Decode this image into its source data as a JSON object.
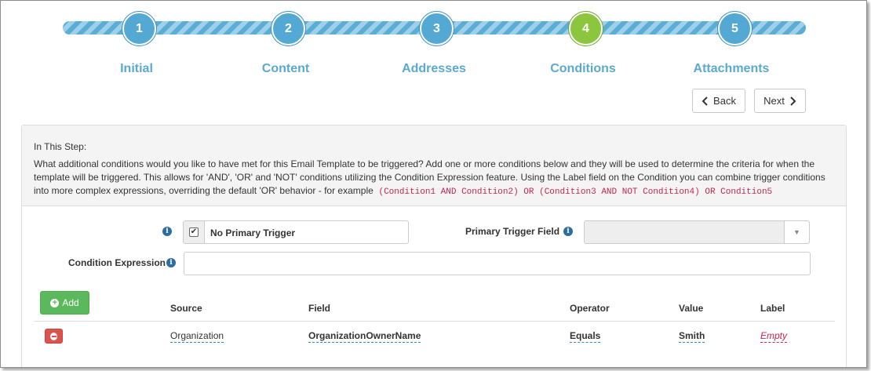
{
  "wizard": {
    "steps": [
      {
        "number": "1",
        "label": "Initial"
      },
      {
        "number": "2",
        "label": "Content"
      },
      {
        "number": "3",
        "label": "Addresses"
      },
      {
        "number": "4",
        "label": "Conditions"
      },
      {
        "number": "5",
        "label": "Attachments"
      }
    ],
    "active_step": 4,
    "colors": {
      "step": "#54a9d4",
      "active": "#8cc63f",
      "label": "#5aa9d1"
    }
  },
  "nav": {
    "back_label": "Back",
    "next_label": "Next",
    "back_icon": "chevron-left-icon",
    "next_icon": "chevron-right-icon"
  },
  "intro": {
    "title": "In This Step:",
    "body_line1": "What additional conditions would you like to have met for this Email Template to be triggered? Add one or more conditions below and they will be used to determine the criteria for when the",
    "body_line2": "template will be triggered. This allows for 'AND', 'OR' and 'NOT' conditions utilizing the Condition Expression feature. Using the Label field on the Condition you can combine trigger conditions",
    "body_line3": "into more complex expressions, overriding the default 'OR' behavior - for example",
    "example_code": "(Condition1 AND Condition2) OR (Condition3 AND NOT Condition4) OR Condition5"
  },
  "form": {
    "no_primary_trigger_label": "No Primary Trigger",
    "no_primary_trigger_checked": true,
    "primary_trigger_field_label": "Primary Trigger Field",
    "primary_trigger_field_value": "",
    "condition_expression_label": "Condition Expression",
    "condition_expression_value": ""
  },
  "conditions": {
    "add_label": "Add",
    "columns": {
      "source": "Source",
      "field": "Field",
      "operator": "Operator",
      "value": "Value",
      "label": "Label"
    },
    "rows": [
      {
        "source": "Organization",
        "field": "OrganizationOwnerName",
        "operator": "Equals",
        "value": "Smith",
        "label": "Empty"
      }
    ]
  }
}
